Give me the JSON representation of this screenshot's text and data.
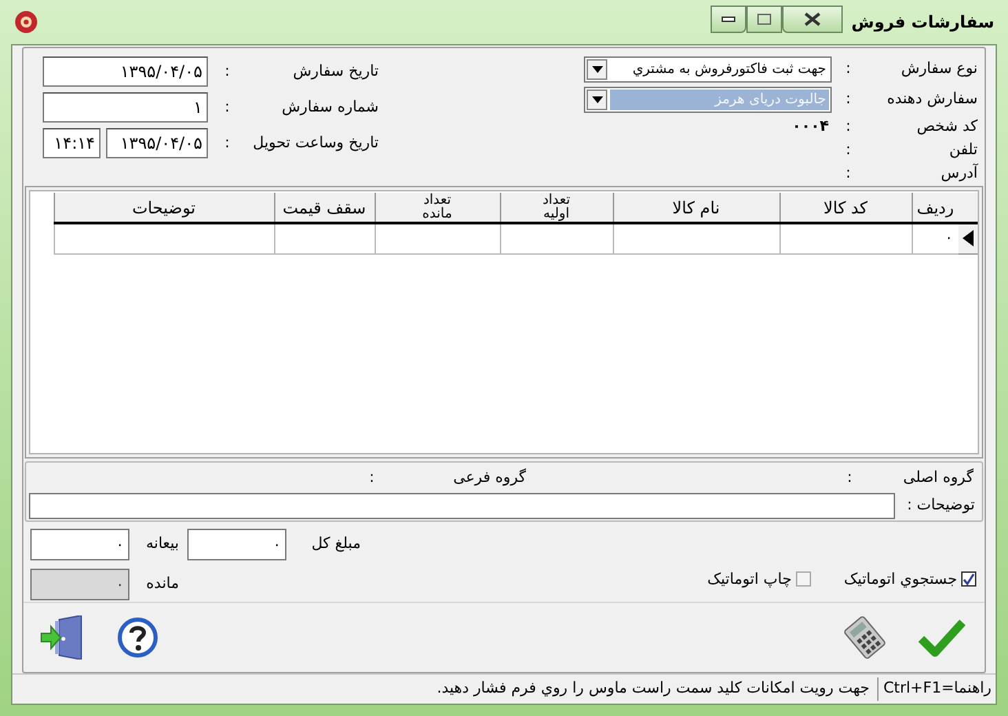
{
  "window": {
    "title": "سفارشات فروش"
  },
  "order_fields": [
    {
      "kind": "dropdown",
      "label": "نوع سفارش",
      "separator": ":",
      "value": "جهت ثبت فاکتورفروش به مشتري",
      "focused": false
    },
    {
      "kind": "dropdown",
      "label": "سفارش دهنده",
      "separator": ":",
      "value": "جالبوت دریای هرمز",
      "focused": true
    },
    {
      "kind": "text",
      "label": "کد شخص",
      "separator": ":",
      "value": "۰۰۰۴"
    },
    {
      "kind": "text",
      "label": "تلفن",
      "separator": ":"
    },
    {
      "kind": "text",
      "label": "آدرس",
      "separator": ":"
    }
  ],
  "date_fields": [
    {
      "label": "تاریخ سفارش",
      "separator": ":",
      "values": [
        "۱۳۹۵/۰۴/۰۵"
      ]
    },
    {
      "label": "شماره سفارش",
      "separator": ":",
      "values": [
        "۱"
      ]
    },
    {
      "label": "تاریخ وساعت تحویل",
      "separator": ":",
      "values": [
        "۱۳۹۵/۰۴/۰۵",
        "۱۴:۱۴"
      ]
    }
  ],
  "table": {
    "columns": [
      [
        "ردیف"
      ],
      [
        "کد کالا"
      ],
      [
        "نام کالا"
      ],
      [
        "تعداد",
        "اولیه"
      ],
      [
        "تعداد",
        "مانده"
      ],
      [
        "سقف قیمت"
      ],
      [
        "توضیحات"
      ]
    ],
    "rows": [
      {
        "current": true,
        "row_number": "۰"
      }
    ]
  },
  "groups": {
    "main_label": "گروه اصلی",
    "main_separator": ":",
    "sub_label": "گروه فرعی",
    "sub_separator": ":",
    "notes_label": "توضیحات :"
  },
  "amounts": [
    {
      "label": "مبلغ کل",
      "value": "۰",
      "readonly": false
    },
    {
      "label": "بیعانه",
      "value": "۰",
      "readonly": false
    },
    {
      "label": "مانده",
      "value": "۰",
      "readonly": true
    }
  ],
  "checkboxes": [
    {
      "label": "جستجوي اتوماتيک",
      "checked": true
    },
    {
      "label": "چاپ اتوماتيک",
      "checked": false
    }
  ],
  "toolbar": [
    {
      "kind": "confirm"
    },
    {
      "kind": "calculator"
    },
    {
      "kind": "help"
    },
    {
      "kind": "exit"
    }
  ],
  "status_bar": {
    "shortcut": "راهنما=Ctrl+F1",
    "message": "جهت رویت امکانات کلید سمت راست ماوس را روي فرم فشار دهید."
  }
}
